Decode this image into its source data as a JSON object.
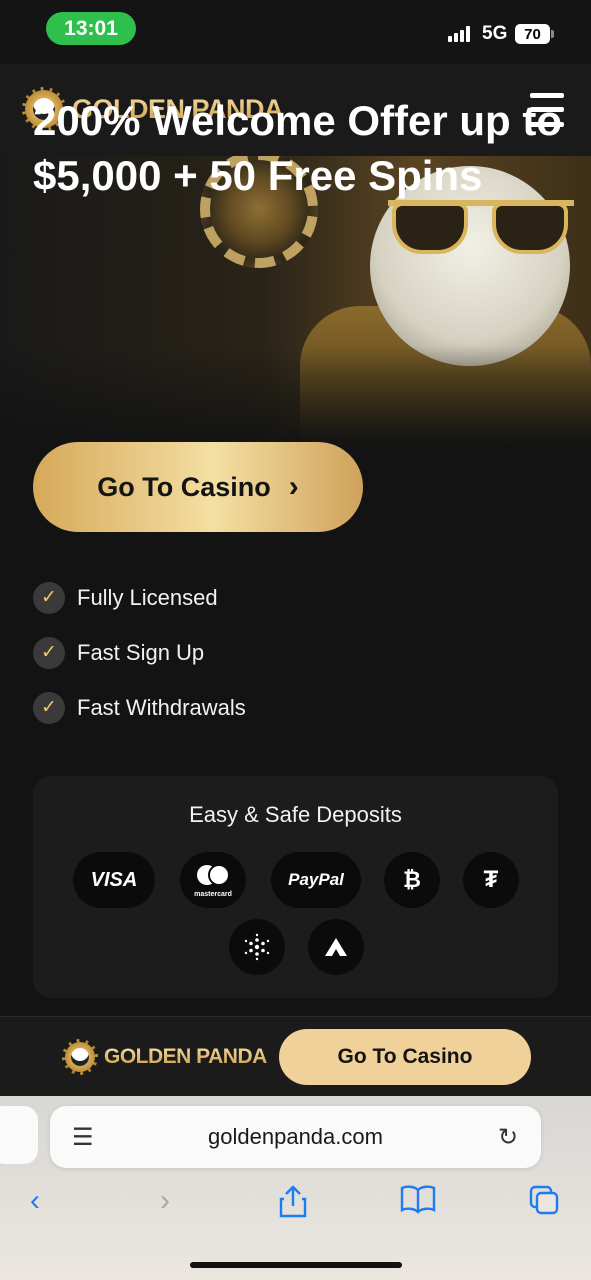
{
  "status_bar": {
    "time": "13:01",
    "network": "5G",
    "battery": "70"
  },
  "header": {
    "brand": "GOLDEN PANDA"
  },
  "hero": {
    "title": "200% Welcome Offer up to $5,000 + 50 Free Spins"
  },
  "cta_main": {
    "label": "Go To Casino",
    "chevron": "›"
  },
  "features": [
    {
      "label": "Fully Licensed"
    },
    {
      "label": "Fast Sign Up"
    },
    {
      "label": "Fast Withdrawals"
    }
  ],
  "deposits": {
    "title": "Easy & Safe Deposits",
    "methods": [
      "VISA",
      "mastercard",
      "PayPal",
      "bitcoin",
      "tether",
      "cardano",
      "avalanche"
    ]
  },
  "sticky_bar": {
    "brand": "GOLDEN PANDA",
    "cta_label": "Go To Casino"
  },
  "browser": {
    "url": "goldenpanda.com"
  },
  "colors": {
    "gold": "#f0d199",
    "accent_check": "#f2c666",
    "status_green": "#2fbf4c",
    "ios_blue": "#1d7cf0"
  }
}
